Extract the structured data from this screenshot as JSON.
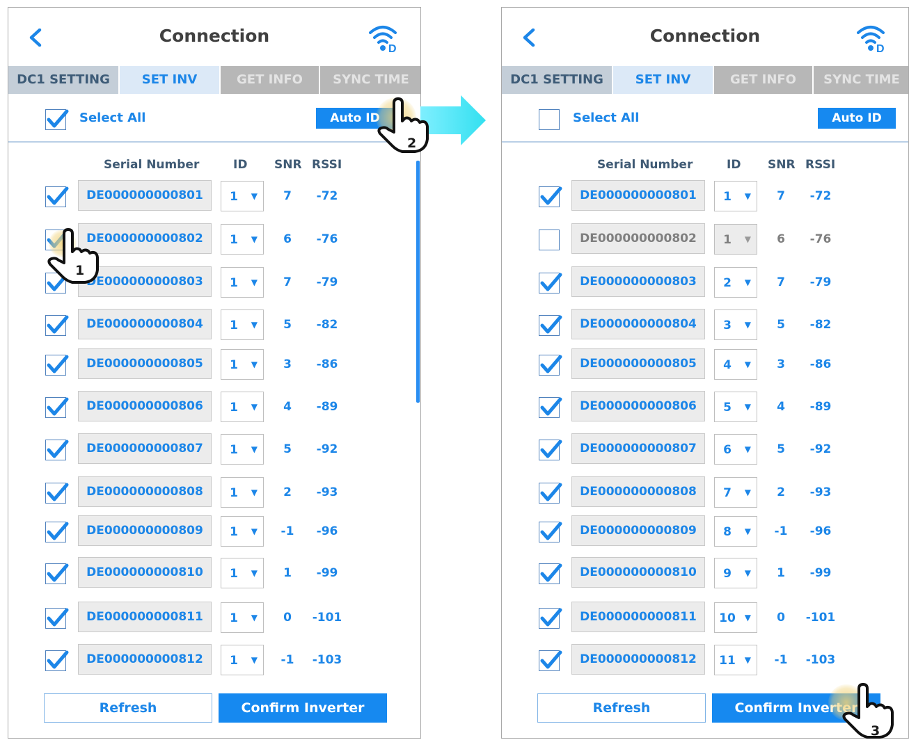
{
  "colors": {
    "accent": "#1689f0",
    "text_blue": "#1c86e8",
    "tab_inactive": "#b7b7b7",
    "tab_dc1": "#c4ced8",
    "arrow": "#4fe6f0"
  },
  "icons": {
    "back": "chevron-left-icon",
    "wifi": "wifi-d-icon",
    "check": "checkmark-icon",
    "hand": "pointer-hand-icon",
    "arrow": "right-arrow-icon"
  },
  "left": {
    "title": "Connection",
    "tabs": [
      "DC1 SETTING",
      "SET INV",
      "GET INFO",
      "SYNC TIME"
    ],
    "select_all_label": "Select All",
    "select_all_checked": true,
    "auto_id_label": "Auto ID",
    "columns": {
      "serial": "Serial Number",
      "id": "ID",
      "snr": "SNR",
      "rssi": "RSSI"
    },
    "rows": [
      {
        "serial": "DE000000000801",
        "id": "1",
        "snr": "7",
        "rssi": "-72",
        "checked": true
      },
      {
        "serial": "DE000000000802",
        "id": "1",
        "snr": "6",
        "rssi": "-76",
        "checked": true
      },
      {
        "serial": "DE000000000803",
        "id": "1",
        "snr": "7",
        "rssi": "-79",
        "checked": true
      },
      {
        "serial": "DE000000000804",
        "id": "1",
        "snr": "5",
        "rssi": "-82",
        "checked": true
      },
      {
        "serial": "DE000000000805",
        "id": "1",
        "snr": "3",
        "rssi": "-86",
        "checked": true
      },
      {
        "serial": "DE000000000806",
        "id": "1",
        "snr": "4",
        "rssi": "-89",
        "checked": true
      },
      {
        "serial": "DE000000000807",
        "id": "1",
        "snr": "5",
        "rssi": "-92",
        "checked": true
      },
      {
        "serial": "DE000000000808",
        "id": "1",
        "snr": "2",
        "rssi": "-93",
        "checked": true
      },
      {
        "serial": "DE000000000809",
        "id": "1",
        "snr": "-1",
        "rssi": "-96",
        "checked": true
      },
      {
        "serial": "DE000000000810",
        "id": "1",
        "snr": "1",
        "rssi": "-99",
        "checked": true
      },
      {
        "serial": "DE000000000811",
        "id": "1",
        "snr": "0",
        "rssi": "-101",
        "checked": true
      },
      {
        "serial": "DE000000000812",
        "id": "1",
        "snr": "-1",
        "rssi": "-103",
        "checked": true
      }
    ],
    "refresh_label": "Refresh",
    "confirm_label": "Confirm Inverter"
  },
  "right": {
    "title": "Connection",
    "tabs": [
      "DC1 SETTING",
      "SET INV",
      "GET INFO",
      "SYNC TIME"
    ],
    "select_all_label": "Select All",
    "select_all_checked": false,
    "auto_id_label": "Auto ID",
    "columns": {
      "serial": "Serial Number",
      "id": "ID",
      "snr": "SNR",
      "rssi": "RSSI"
    },
    "rows": [
      {
        "serial": "DE000000000801",
        "id": "1",
        "snr": "7",
        "rssi": "-72",
        "checked": true
      },
      {
        "serial": "DE000000000802",
        "id": "1",
        "snr": "6",
        "rssi": "-76",
        "checked": false
      },
      {
        "serial": "DE000000000803",
        "id": "2",
        "snr": "7",
        "rssi": "-79",
        "checked": true
      },
      {
        "serial": "DE000000000804",
        "id": "3",
        "snr": "5",
        "rssi": "-82",
        "checked": true
      },
      {
        "serial": "DE000000000805",
        "id": "4",
        "snr": "3",
        "rssi": "-86",
        "checked": true
      },
      {
        "serial": "DE000000000806",
        "id": "5",
        "snr": "4",
        "rssi": "-89",
        "checked": true
      },
      {
        "serial": "DE000000000807",
        "id": "6",
        "snr": "5",
        "rssi": "-92",
        "checked": true
      },
      {
        "serial": "DE000000000808",
        "id": "7",
        "snr": "2",
        "rssi": "-93",
        "checked": true
      },
      {
        "serial": "DE000000000809",
        "id": "8",
        "snr": "-1",
        "rssi": "-96",
        "checked": true
      },
      {
        "serial": "DE000000000810",
        "id": "9",
        "snr": "1",
        "rssi": "-99",
        "checked": true
      },
      {
        "serial": "DE000000000811",
        "id": "10",
        "snr": "0",
        "rssi": "-101",
        "checked": true
      },
      {
        "serial": "DE000000000812",
        "id": "11",
        "snr": "-1",
        "rssi": "-103",
        "checked": true
      }
    ],
    "refresh_label": "Refresh",
    "confirm_label": "Confirm Inverter"
  },
  "steps": [
    "1",
    "2",
    "3"
  ]
}
